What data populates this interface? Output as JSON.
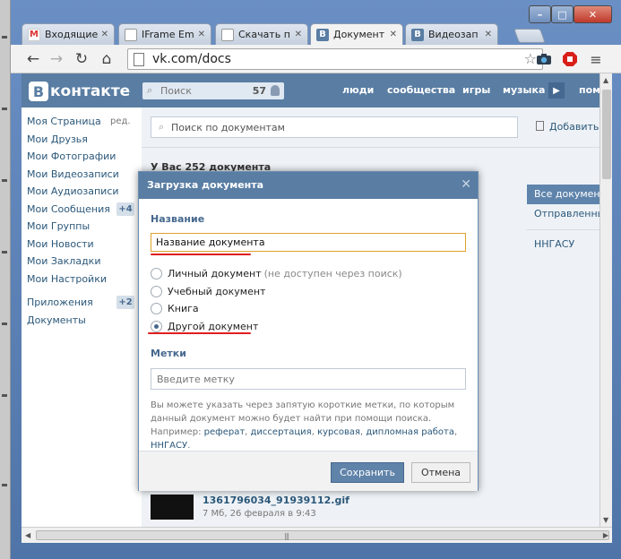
{
  "browser": {
    "tabs": [
      {
        "title": "Входящие",
        "favicon": "gmail-icon",
        "active": false
      },
      {
        "title": "IFrame Em",
        "favicon": "page-icon",
        "active": false
      },
      {
        "title": "Скачать п",
        "favicon": "page-icon",
        "active": false
      },
      {
        "title": "Документ",
        "favicon": "vk-icon",
        "active": true
      },
      {
        "title": "Видеозап",
        "favicon": "vk-icon",
        "active": false
      }
    ],
    "url": "vk.com/docs"
  },
  "vk": {
    "logo_letter": "B",
    "logo_word": "контакте",
    "search_placeholder": "Поиск",
    "search_count": "57",
    "nav": [
      "люди",
      "сообщества",
      "игры",
      "музыка",
      "пом"
    ]
  },
  "sidebar": {
    "items": [
      {
        "label": "Моя Страница",
        "extra": "ред."
      },
      {
        "label": "Мои Друзья"
      },
      {
        "label": "Мои Фотографии"
      },
      {
        "label": "Мои Видеозаписи"
      },
      {
        "label": "Мои Аудиозаписи"
      },
      {
        "label": "Мои Сообщения",
        "badge": "+4"
      },
      {
        "label": "Мои Группы"
      },
      {
        "label": "Мои Новости"
      },
      {
        "label": "Мои Закладки"
      },
      {
        "label": "Мои Настройки"
      },
      {
        "label": "Приложения",
        "badge": "+2"
      },
      {
        "label": "Документы"
      }
    ]
  },
  "docs": {
    "search_placeholder": "Поиск по документам",
    "add_label": "Добавить д",
    "count_label": "У Вас 252 документа",
    "filters": [
      "Все документы",
      "Отправленные",
      "ННГАСУ"
    ],
    "row": {
      "name": "1361796034_91939112.gif",
      "meta": "7 Мб, 26 февраля в 9:43"
    }
  },
  "dialog": {
    "title": "Загрузка документа",
    "close": "✕",
    "name_label": "Название",
    "name_value": "Название документа",
    "options": [
      {
        "label": "Личный документ",
        "note": "(не доступен через поиск)",
        "checked": false
      },
      {
        "label": "Учебный документ",
        "checked": false
      },
      {
        "label": "Книга",
        "checked": false
      },
      {
        "label": "Другой документ",
        "checked": true
      }
    ],
    "tags_label": "Метки",
    "tags_placeholder": "Введите метку",
    "hint_text": "Вы можете указать через запятую короткие метки, по которым данный документ можно будет найти при помощи поиска. Например:",
    "hint_links": [
      "реферат",
      "диссертация",
      "курсовая",
      "дипломная работа",
      "ННГАСУ"
    ],
    "save_label": "Сохранить",
    "cancel_label": "Отмена"
  },
  "colors": {
    "vk_blue": "#597da3",
    "link": "#2b587a",
    "focus_border": "#e0a12c",
    "annotation_red": "#e01e1e"
  }
}
